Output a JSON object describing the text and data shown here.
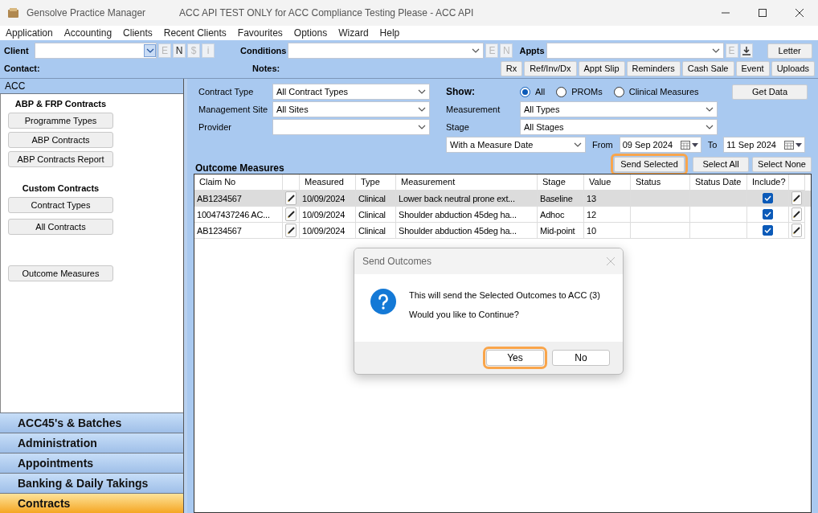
{
  "window": {
    "app_title": "Gensolve Practice Manager",
    "title": "ACC API TEST ONLY for ACC Compliance Testing Please - ACC API"
  },
  "menu": [
    "Application",
    "Accounting",
    "Clients",
    "Recent Clients",
    "Favourites",
    "Options",
    "Wizard",
    "Help"
  ],
  "toolbar": {
    "client_label": "Client",
    "client_buttons": [
      {
        "label": "E",
        "disabled": true
      },
      {
        "label": "N",
        "disabled": false
      },
      {
        "label": "$",
        "disabled": true
      },
      {
        "label": "i",
        "disabled": true
      }
    ],
    "conditions_label": "Conditions",
    "conditions_buttons": [
      {
        "label": "E",
        "disabled": true
      },
      {
        "label": "N",
        "disabled": true
      }
    ],
    "appts_label": "Appts",
    "appts_buttons": [
      {
        "label": "E",
        "disabled": true
      }
    ],
    "letter": "Letter",
    "contact_label": "Contact:",
    "notes_label": "Notes:",
    "actions": [
      "Rx",
      "Ref/Inv/Dx",
      "Appt Slip",
      "Reminders",
      "Cash Sale",
      "Event",
      "Uploads"
    ]
  },
  "sidebar": {
    "header": "ACC",
    "sections": [
      {
        "title": "ABP & FRP Contracts",
        "buttons": [
          "Programme Types",
          "ABP Contracts",
          "ABP Contracts Report"
        ]
      },
      {
        "title": "Custom Contracts",
        "buttons": [
          "Contract Types",
          "All Contracts"
        ]
      },
      {
        "buttons": [
          "Outcome Measures"
        ]
      }
    ],
    "nav": [
      {
        "label": "ACC45's & Batches",
        "selected": false
      },
      {
        "label": "Administration",
        "selected": false
      },
      {
        "label": "Appointments",
        "selected": false
      },
      {
        "label": "Banking & Daily Takings",
        "selected": false
      },
      {
        "label": "Contracts",
        "selected": true
      }
    ]
  },
  "filters": {
    "left": [
      {
        "label": "Contract Type",
        "value": "All Contract Types"
      },
      {
        "label": "Management Site",
        "value": "All Sites"
      },
      {
        "label": "Provider"
      }
    ],
    "show_label": "Show:",
    "show_options": [
      {
        "label": "All",
        "selected": true
      },
      {
        "label": "PROMs",
        "selected": false
      },
      {
        "label": "Clinical Measures",
        "selected": false
      }
    ],
    "right": [
      {
        "label": "Measurement",
        "value": "All Types"
      },
      {
        "label": "Stage",
        "value": "All Stages"
      }
    ],
    "date_mode": "With a Measure Date",
    "from_label": "From",
    "from": "09 Sep 2024",
    "to_label": "To",
    "to": "11 Sep 2024",
    "get_data": "Get Data"
  },
  "outcomes": {
    "title": "Outcome Measures",
    "buttons": [
      {
        "label": "Send Selected",
        "highlighted": true
      },
      {
        "label": "Select All",
        "highlighted": false
      },
      {
        "label": "Select None",
        "highlighted": false
      }
    ],
    "columns": [
      {
        "kind": "text",
        "label": "Claim No"
      },
      {
        "kind": "edit"
      },
      {
        "kind": "text",
        "label": "Measured"
      },
      {
        "kind": "text",
        "label": "Type"
      },
      {
        "kind": "text",
        "label": "Measurement"
      },
      {
        "kind": "text",
        "label": "Stage"
      },
      {
        "kind": "text",
        "label": "Value"
      },
      {
        "kind": "text",
        "label": "Status"
      },
      {
        "kind": "text",
        "label": "Status Date"
      },
      {
        "kind": "text",
        "label": "Include?"
      },
      {
        "kind": "edit"
      }
    ],
    "rows": [
      {
        "selected": true,
        "claim_no": "AB1234567",
        "measured": "10/09/2024",
        "type": "Clinical",
        "measurement": "Lower back neutral prone ext...",
        "stage": "Baseline",
        "value": "13",
        "include": true
      },
      {
        "selected": false,
        "claim_no": "10047437246 AC...",
        "measured": "10/09/2024",
        "type": "Clinical",
        "measurement": "Shoulder abduction 45deg ha...",
        "stage": "Adhoc",
        "value": "12",
        "include": true
      },
      {
        "selected": false,
        "claim_no": "AB1234567",
        "measured": "10/09/2024",
        "type": "Clinical",
        "measurement": "Shoulder abduction 45deg ha...",
        "stage": "Mid-point",
        "value": "10",
        "include": true
      }
    ]
  },
  "dialog": {
    "title": "Send Outcomes",
    "message": "This will send the Selected Outcomes to ACC (3)",
    "question": "Would you like to Continue?",
    "buttons": [
      {
        "label": "Yes",
        "highlighted": true
      },
      {
        "label": "No",
        "highlighted": false
      }
    ]
  }
}
